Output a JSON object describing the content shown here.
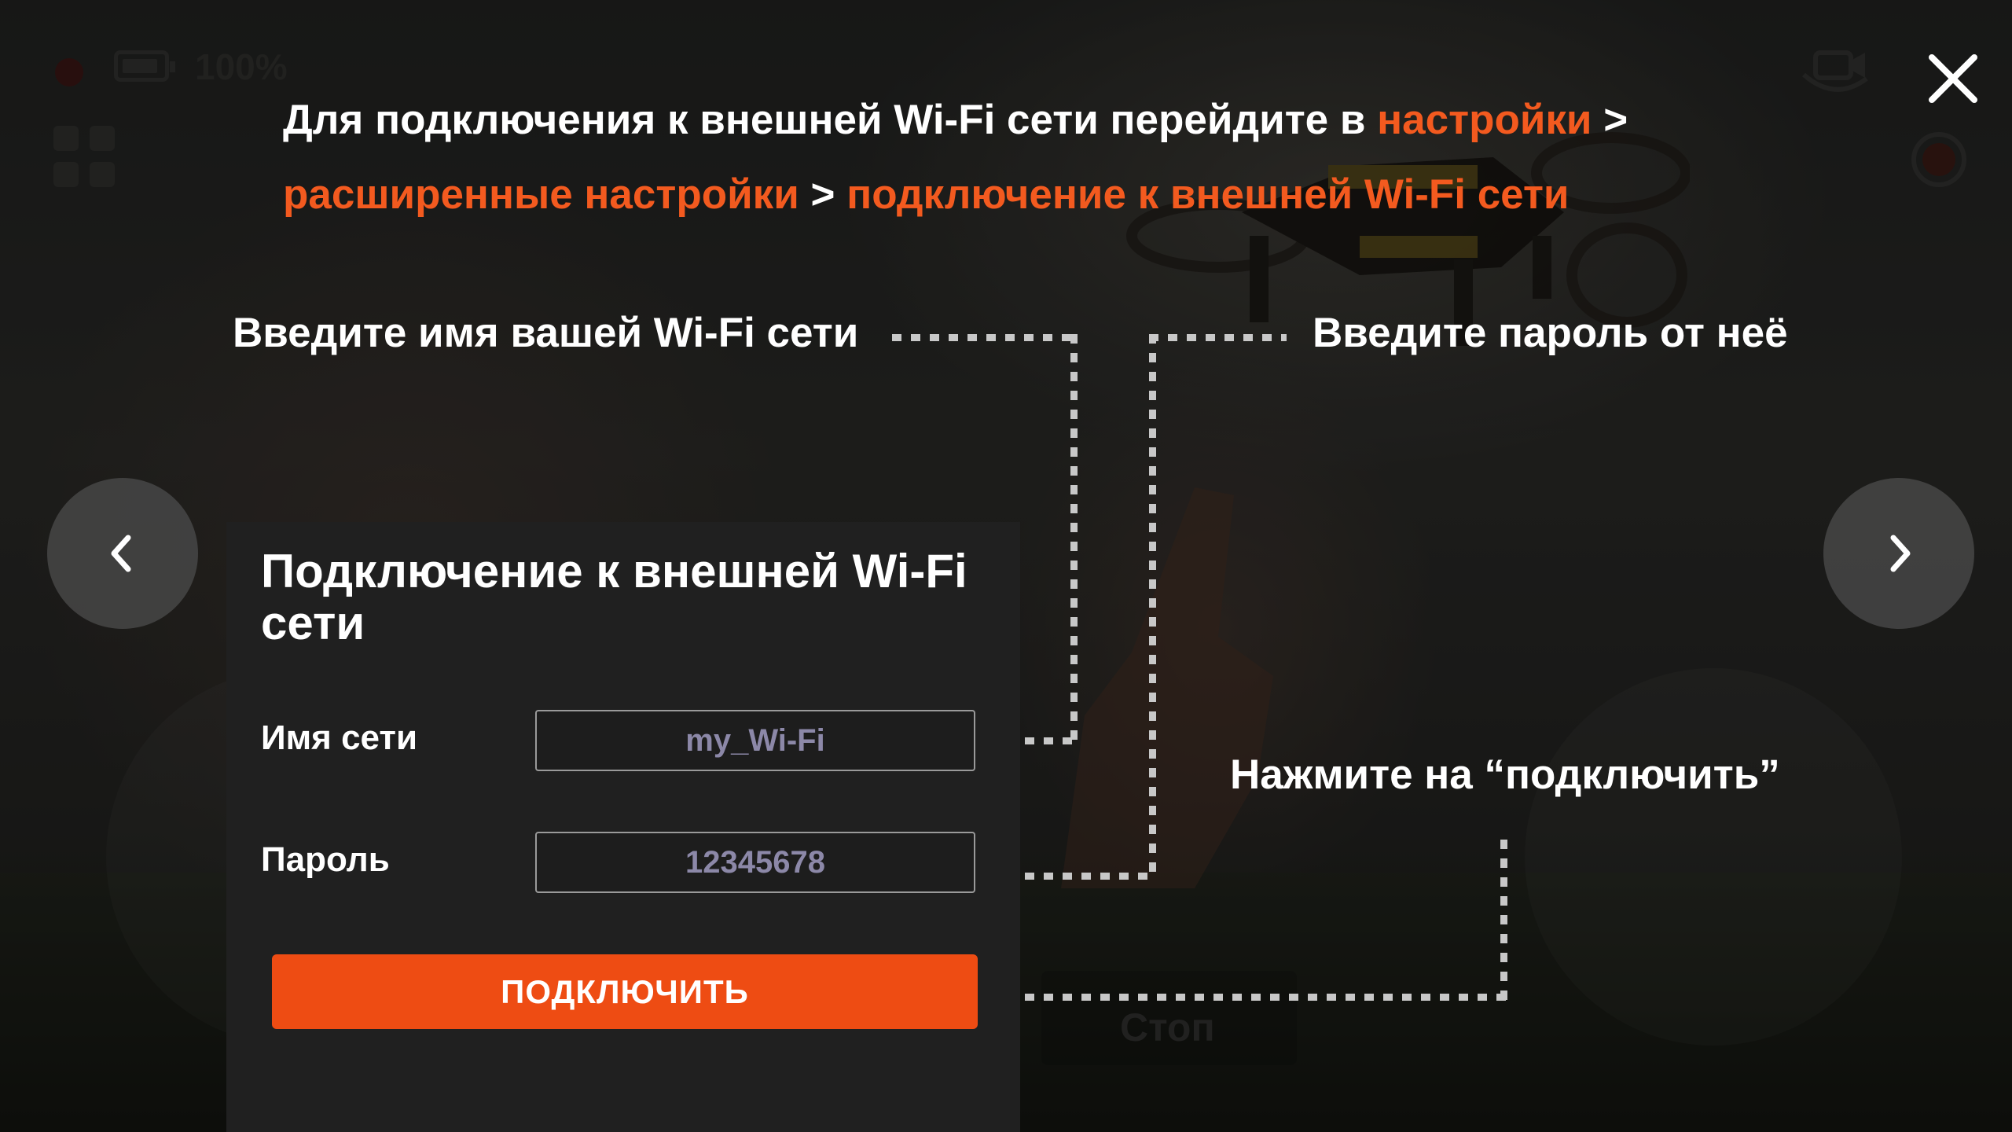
{
  "hud": {
    "battery_percent": "100%",
    "stop_label": "Стоп"
  },
  "intro": {
    "part1": "Для подключения к внешней Wi-Fi сети перейдите в ",
    "link_settings": "настройки",
    "sep1": " > ",
    "link_advanced": "расширенные настройки",
    "sep2": " > ",
    "link_external": "подключение к внешней Wi-Fi сети"
  },
  "hints": {
    "ssid": "Введите имя вашей Wi-Fi сети",
    "password": "Введите пароль от неё",
    "connect": "Нажмите на “подключить”"
  },
  "panel": {
    "title": "Подключение к внешней Wi-Fi сети",
    "ssid_label": "Имя сети",
    "ssid_value": "my_Wi-Fi",
    "password_label": "Пароль",
    "password_value": "12345678",
    "connect_button": "ПОДКЛЮЧИТЬ"
  },
  "icons": {
    "close": "close-icon",
    "prev": "chevron-left-icon",
    "next": "chevron-right-icon"
  },
  "colors": {
    "accent": "#f35a1f",
    "button": "#ee4c13"
  }
}
